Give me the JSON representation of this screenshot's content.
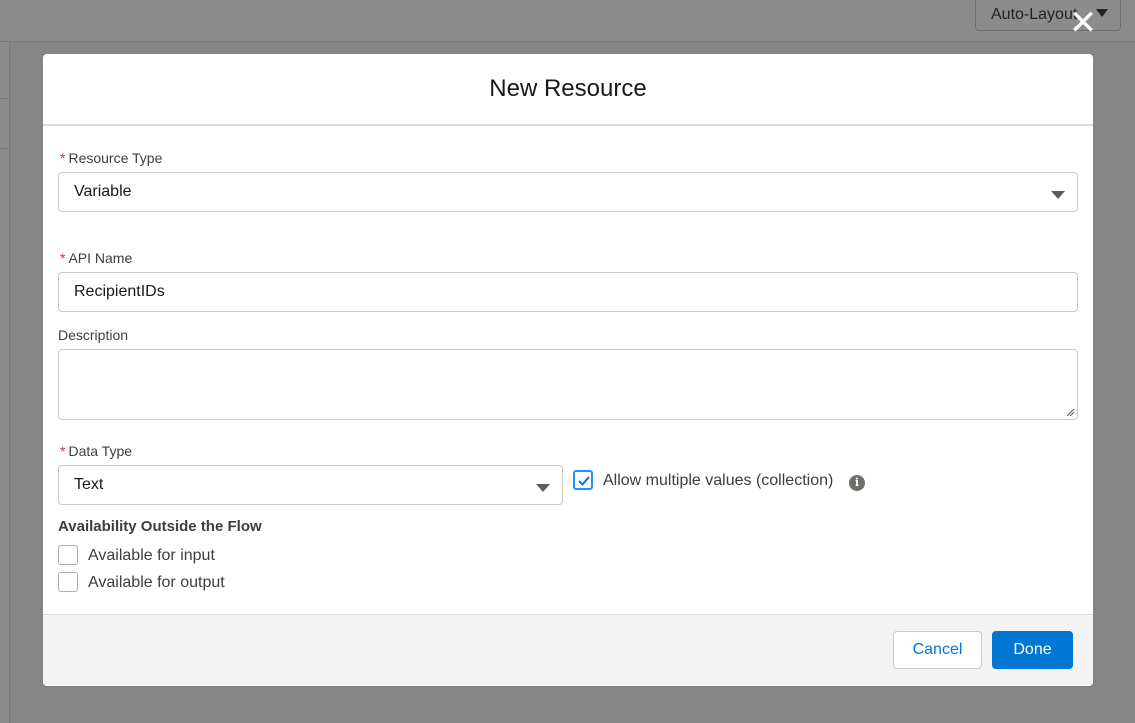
{
  "background": {
    "auto_layout_label": "Auto-Layout"
  },
  "modal": {
    "title": "New Resource",
    "resource_type": {
      "label": "Resource Type",
      "required_mark": "*",
      "value": "Variable"
    },
    "api_name": {
      "label": "API Name",
      "required_mark": "*",
      "value": "RecipientIDs"
    },
    "description": {
      "label": "Description",
      "value": ""
    },
    "data_type": {
      "label": "Data Type",
      "required_mark": "*",
      "value": "Text"
    },
    "allow_multiple": {
      "label": "Allow multiple values (collection)",
      "checked": true,
      "info_icon": "info-icon"
    },
    "availability": {
      "heading": "Availability Outside the Flow",
      "input_label": "Available for input",
      "input_checked": false,
      "output_label": "Available for output",
      "output_checked": false
    },
    "footer": {
      "cancel_label": "Cancel",
      "done_label": "Done"
    }
  },
  "colors": {
    "brand": "#0176d3",
    "required": "#c23934",
    "checkbox_focus": "#1b96ff"
  }
}
